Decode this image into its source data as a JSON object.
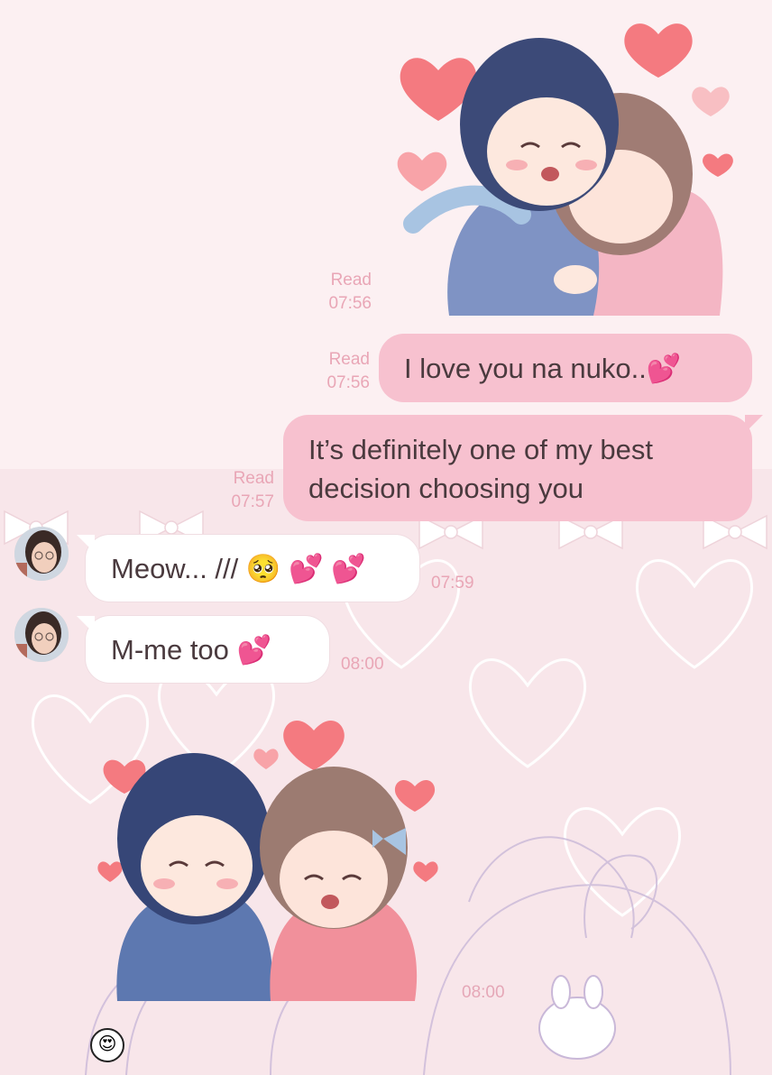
{
  "messages": [
    {
      "id": "m1",
      "direction": "outgoing",
      "kind": "sticker",
      "sticker": "couple-hug-sticker",
      "read": "Read",
      "time": "07:56"
    },
    {
      "id": "m2",
      "direction": "outgoing",
      "kind": "text",
      "text": "I love you na nuko..💕",
      "read": "Read",
      "time": "07:56"
    },
    {
      "id": "m3",
      "direction": "outgoing",
      "kind": "text",
      "lines": [
        "It’s definitely one of my best",
        "decision choosing you"
      ],
      "read": "Read",
      "time": "07:57"
    },
    {
      "id": "m4",
      "direction": "incoming",
      "kind": "text",
      "text": "Meow... /// 🥺 💕 💕",
      "time": "07:59"
    },
    {
      "id": "m5",
      "direction": "incoming",
      "kind": "text",
      "text": "M-me too 💕",
      "time": "08:00"
    },
    {
      "id": "m6",
      "direction": "incoming",
      "kind": "sticker",
      "sticker": "couple-cuddle-sticker",
      "time": "08:00"
    }
  ],
  "reaction": {
    "emoji": "😍"
  },
  "colors": {
    "outgoing_bubble": "#f7c1cf",
    "incoming_bubble": "#ffffff",
    "meta_text": "#e9a6b6",
    "background": "#fbeef1",
    "heart": "#f47a80"
  }
}
